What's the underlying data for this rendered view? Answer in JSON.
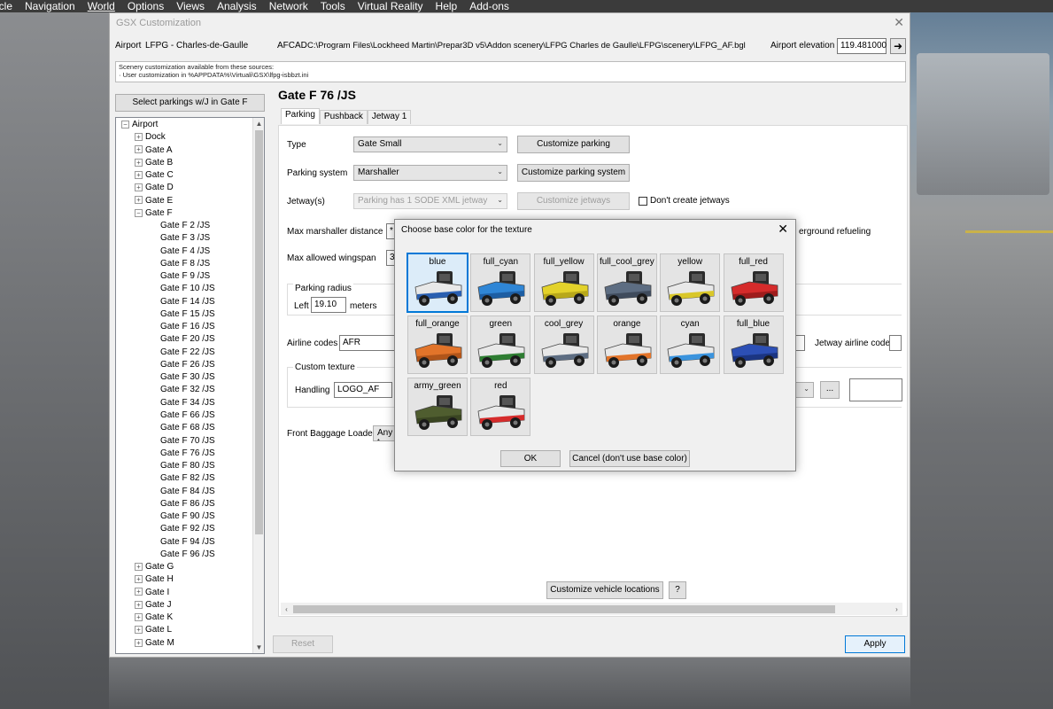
{
  "menubar": [
    "icle",
    "Navigation",
    "World",
    "Options",
    "Views",
    "Analysis",
    "Network",
    "Tools",
    "Virtual Reality",
    "Help",
    "Add-ons"
  ],
  "window": {
    "title": "GSX Customization",
    "airport_label": "Airport",
    "airport_value": "LFPG - Charles-de-Gaulle",
    "afcad_label": "AFCAD",
    "afcad_value": "C:\\Program Files\\Lockheed Martin\\Prepar3D v5\\Addon scenery\\LFPG Charles de Gaulle\\LFPG\\scenery\\LFPG_AF.bgl",
    "elevation_label": "Airport elevation",
    "elevation_value": "119.481000",
    "sources_line1": "Scenery customization available from these sources:",
    "sources_line2": "· User customization in %APPDATA%\\Virtuali\\GSX\\lfpg-isbbzt.ini",
    "select_parkings": "Select parkings w/J in Gate F"
  },
  "tree": {
    "root": "Airport",
    "groups_before": [
      "Dock",
      "Gate A",
      "Gate B",
      "Gate C",
      "Gate D",
      "Gate E"
    ],
    "expanded": "Gate F",
    "children": [
      "Gate F 2 /JS",
      "Gate F 3 /JS",
      "Gate F 4 /JS",
      "Gate F 8 /JS",
      "Gate F 9 /JS",
      "Gate F 10 /JS",
      "Gate F 14 /JS",
      "Gate F 15 /JS",
      "Gate F 16 /JS",
      "Gate F 20 /JS",
      "Gate F 22 /JS",
      "Gate F 26 /JS",
      "Gate F 30 /JS",
      "Gate F 32 /JS",
      "Gate F 34 /JS",
      "Gate F 66 /JS",
      "Gate F 68 /JS",
      "Gate F 70 /JS",
      "Gate F 76 /JS",
      "Gate F 80 /JS",
      "Gate F 82 /JS",
      "Gate F 84 /JS",
      "Gate F 86 /JS",
      "Gate F 90 /JS",
      "Gate F 92 /JS",
      "Gate F 94 /JS",
      "Gate F 96 /JS"
    ],
    "groups_after": [
      "Gate G",
      "Gate H",
      "Gate I",
      "Gate J",
      "Gate K",
      "Gate L",
      "Gate M"
    ]
  },
  "panel": {
    "gate_title": "Gate F 76 /JS",
    "tabs": [
      "Parking",
      "Pushback",
      "Jetway 1"
    ],
    "type_label": "Type",
    "type_value": "Gate Small",
    "customize_parking": "Customize parking",
    "parking_system_label": "Parking system",
    "parking_system_value": "Marshaller",
    "customize_parking_system": "Customize parking system",
    "jetways_label": "Jetway(s)",
    "jetways_value": "Parking has 1 SODE XML jetway",
    "customize_jetways": "Customize jetways",
    "dont_create_jetways": "Don't create jetways",
    "max_marshaller_label": "Max marshaller distance",
    "max_marshaller_value": "*",
    "underground_refueling": "erground refueling",
    "max_wingspan_label": "Max allowed wingspan",
    "max_wingspan_value": "3",
    "parking_radius_label": "Parking radius",
    "left_label": "Left",
    "left_value": "19.10",
    "meters": "meters",
    "airline_codes_label": "Airline codes",
    "airline_codes_value": "AFR",
    "jetway_airline_code_label": "Jetway airline code",
    "custom_texture_label": "Custom texture",
    "handling_label": "Handling",
    "handling_value": "LOGO_AF",
    "ellipsis": "...",
    "front_baggage_label": "Front Baggage Loader",
    "front_baggage_value": "Any t",
    "customize_vehicle_locations": "Customize vehicle locations",
    "help": "?"
  },
  "footer": {
    "reset": "Reset",
    "apply": "Apply"
  },
  "dialog": {
    "title": "Choose base color for the texture",
    "ok": "OK",
    "cancel": "Cancel (don't use base color)",
    "swatches": [
      {
        "name": "blue",
        "color": "#e8e8e8",
        "accent": "#2a5fb0"
      },
      {
        "name": "full_cyan",
        "color": "#2f86d6",
        "accent": "#1d5ea3"
      },
      {
        "name": "full_yellow",
        "color": "#e3d22a",
        "accent": "#b8a81a"
      },
      {
        "name": "full_cool_grey",
        "color": "#5d6d82",
        "accent": "#3f4b5c"
      },
      {
        "name": "yellow",
        "color": "#e8e8e8",
        "accent": "#d9c72a"
      },
      {
        "name": "full_red",
        "color": "#d52b2b",
        "accent": "#9e1c1c"
      },
      {
        "name": "full_orange",
        "color": "#e2742a",
        "accent": "#b0551a"
      },
      {
        "name": "green",
        "color": "#e8e8e8",
        "accent": "#2e7d32"
      },
      {
        "name": "cool_grey",
        "color": "#e8e8e8",
        "accent": "#5d6d82"
      },
      {
        "name": "orange",
        "color": "#e8e8e8",
        "accent": "#e2742a"
      },
      {
        "name": "cyan",
        "color": "#e8e8e8",
        "accent": "#3a93dd"
      },
      {
        "name": "full_blue",
        "color": "#2c4fb5",
        "accent": "#1b3582"
      },
      {
        "name": "army_green",
        "color": "#4f5d2f",
        "accent": "#3a4522"
      },
      {
        "name": "red",
        "color": "#e8e8e8",
        "accent": "#d52b2b"
      }
    ],
    "selected": "blue"
  }
}
